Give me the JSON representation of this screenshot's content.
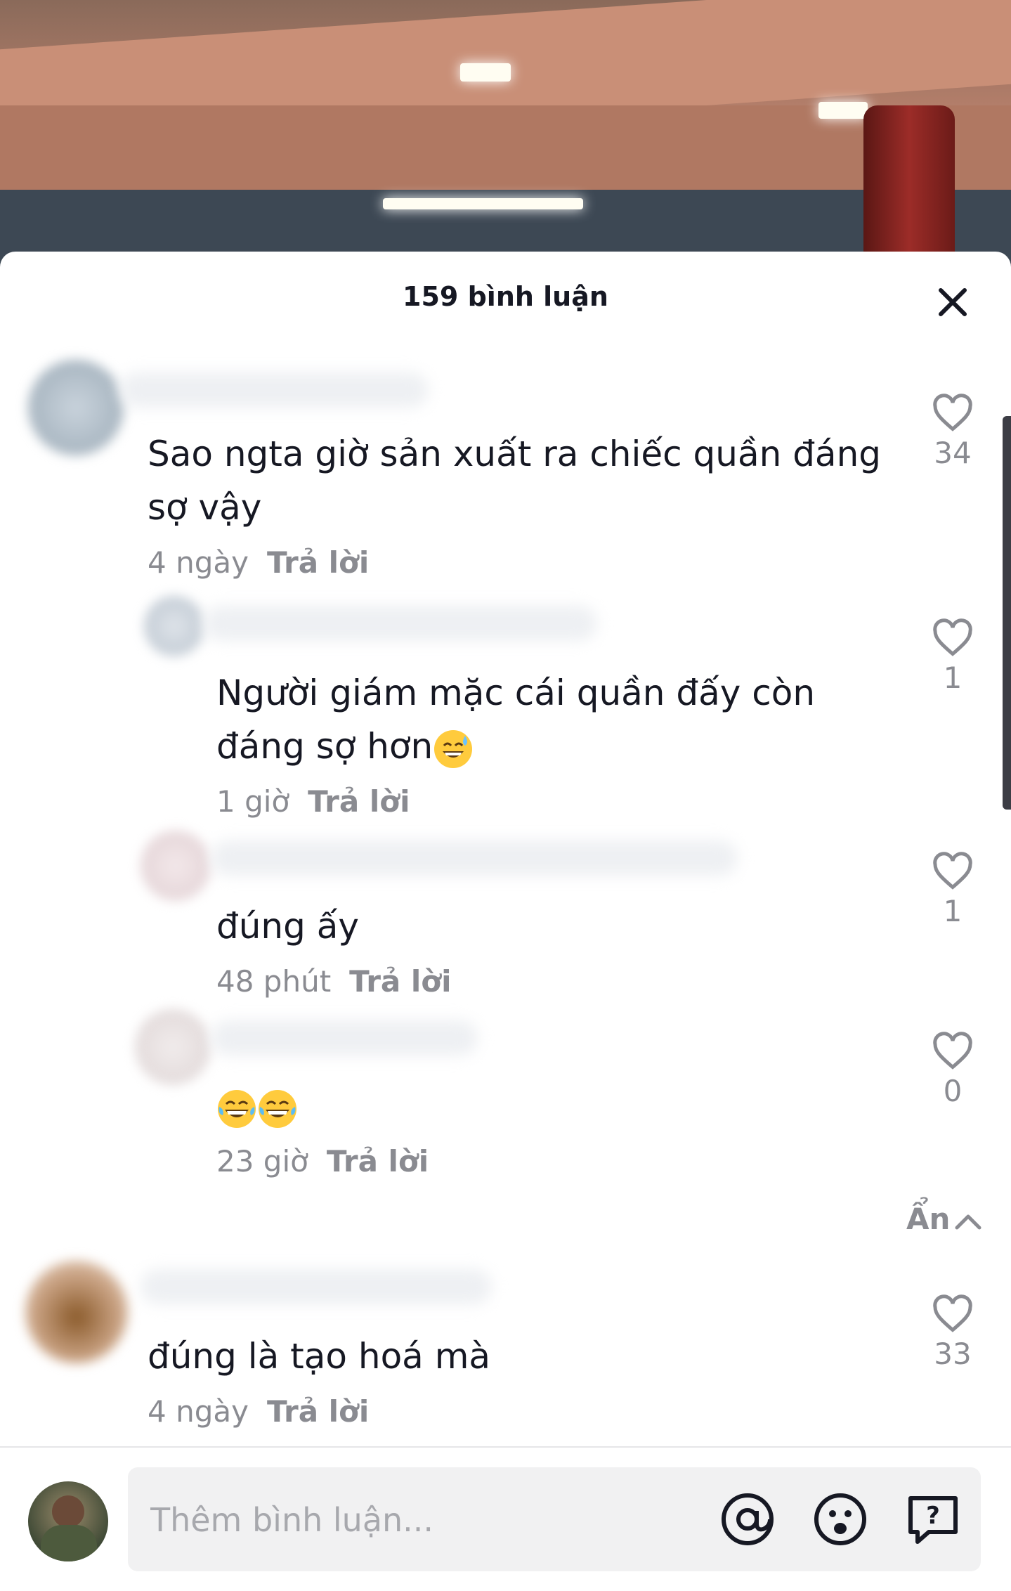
{
  "header": {
    "title": "159 bình luận"
  },
  "comments": [
    {
      "text": "Sao ngta giờ sản xuất ra chiếc quần đáng sợ vậy",
      "time": "4 ngày",
      "reply": "Trả lời",
      "likes": "34"
    },
    {
      "text": "Người giám mặc cái quần đấy còn đáng sợ hơn",
      "time": "1 giờ",
      "reply": "Trả lời",
      "likes": "1"
    },
    {
      "text": "đúng ấy",
      "time": "48 phút",
      "reply": "Trả lời",
      "likes": "1"
    },
    {
      "text": "",
      "time": "23 giờ",
      "reply": "Trả lời",
      "likes": "0"
    },
    {
      "text": "đúng là tạo hoá mà",
      "time": "4 ngày",
      "reply": "Trả lời",
      "likes": "33"
    }
  ],
  "hide_replies": "Ẩn",
  "composer": {
    "placeholder": "Thêm bình luận..."
  },
  "icons": [
    "close-icon",
    "heart-icon",
    "chevron-up-icon",
    "at-mention-icon",
    "emoji-icon",
    "question-icon"
  ],
  "colors": {
    "text": "#161823",
    "muted": "#8a8b91",
    "input_bg": "#f1f1f2"
  }
}
